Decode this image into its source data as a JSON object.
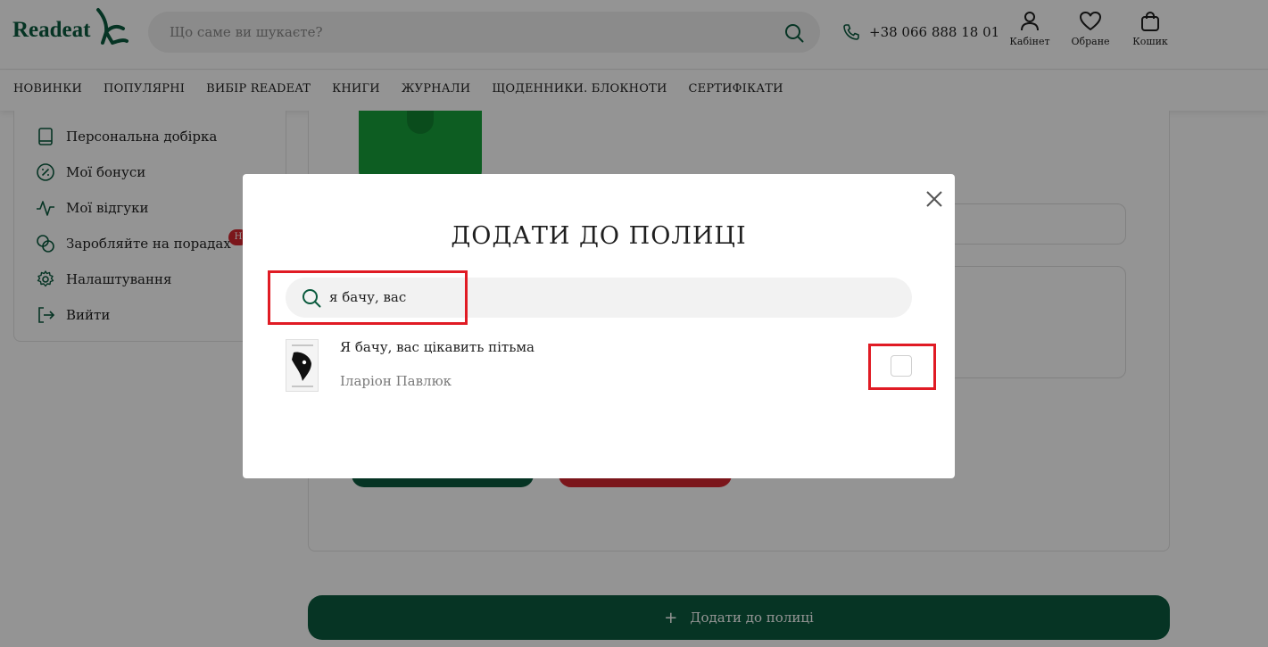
{
  "header": {
    "logo": "Readeat",
    "search_placeholder": "Що саме ви шукаєте?",
    "phone": "+38 066 888 18 01",
    "icons": [
      {
        "label": "Кабінет",
        "icon": "user-icon"
      },
      {
        "label": "Обране",
        "icon": "heart-icon"
      },
      {
        "label": "Кошик",
        "icon": "bag-icon"
      }
    ]
  },
  "nav": [
    "НОВИНКИ",
    "ПОПУЛЯРНІ",
    "ВИБІР READEAT",
    "КНИГИ",
    "ЖУРНАЛИ",
    "ЩОДЕННИКИ. БЛОКНОТИ",
    "СЕРТИФІКАТИ"
  ],
  "sidebar": {
    "items": [
      {
        "label": "Персональна добірка",
        "icon": "book-icon"
      },
      {
        "label": "Мої бонуси",
        "icon": "percent-icon"
      },
      {
        "label": "Мої відгуки",
        "icon": "activity-icon"
      },
      {
        "label": "Заробляйте на порадах",
        "icon": "coins-icon",
        "badge": "Н"
      },
      {
        "label": "Налаштування",
        "icon": "gear-icon"
      },
      {
        "label": "Вийти",
        "icon": "logout-icon"
      }
    ]
  },
  "main": {
    "add_shelf_label": "Додати до полиці"
  },
  "modal": {
    "title": "ДОДАТИ ДО ПОЛИЦІ",
    "search_value": "я бачу, вас",
    "results": [
      {
        "title": "Я бачу, вас цікавить пітьма",
        "author": "Іларіон Павлюк",
        "checked": false
      }
    ]
  },
  "colors": {
    "brand": "#0b5b3e",
    "danger": "#d5262f",
    "highlight": "#e01b24"
  }
}
